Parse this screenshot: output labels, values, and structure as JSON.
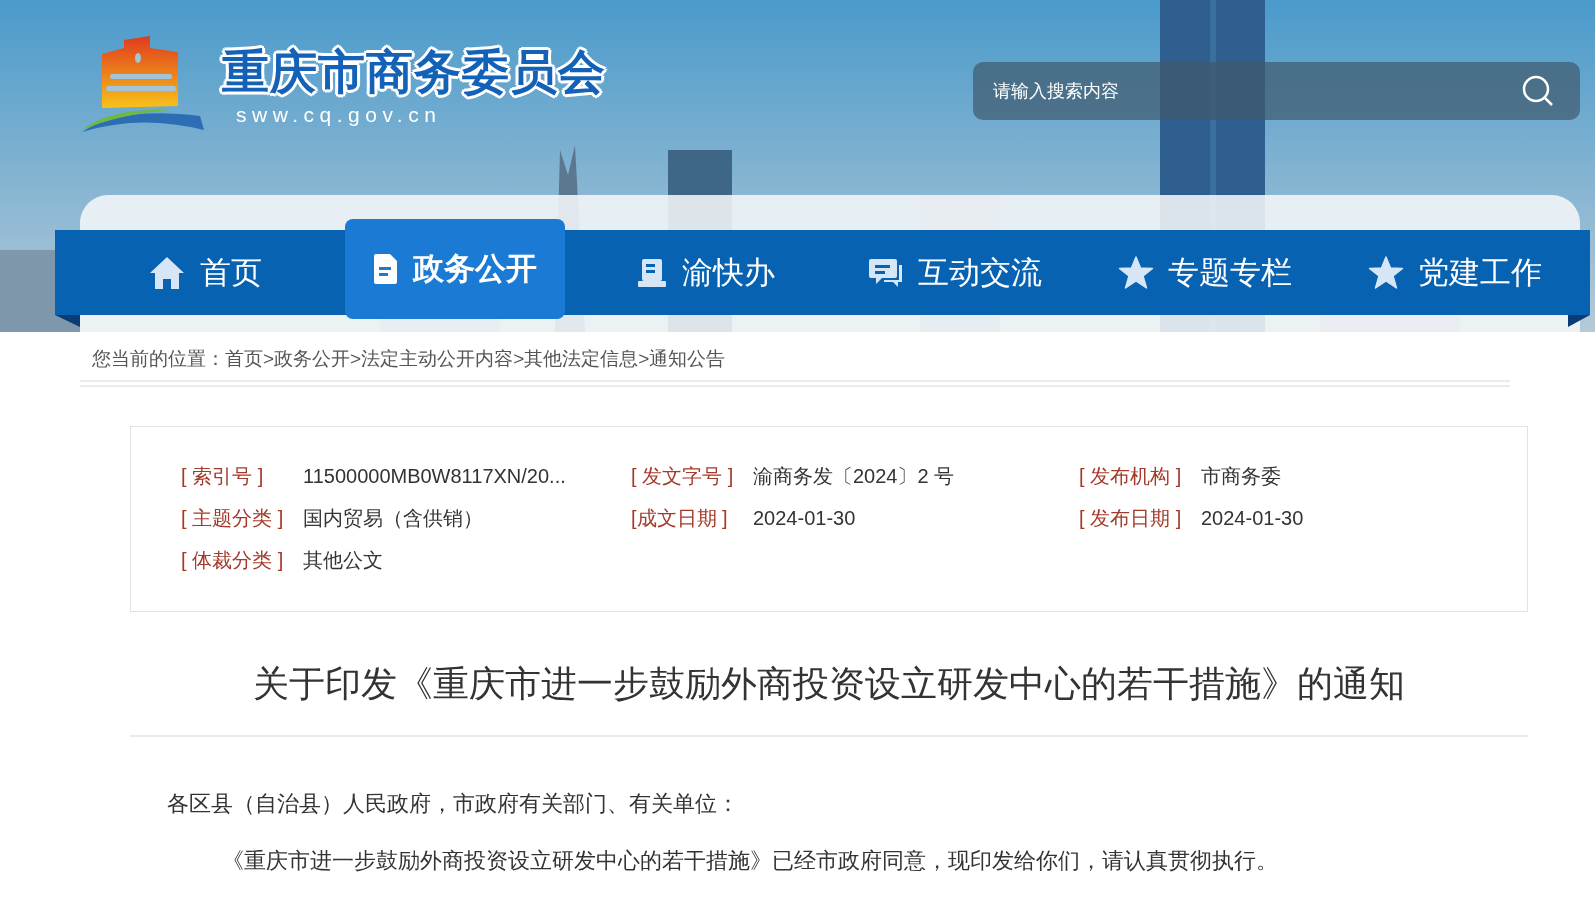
{
  "header": {
    "site_name": "重庆市商务委员会",
    "site_domain": "sww.cq.gov.cn",
    "search": {
      "placeholder": "请输入搜索内容"
    }
  },
  "nav": [
    {
      "label": "首页",
      "selected": false
    },
    {
      "label": "政务公开",
      "selected": true
    },
    {
      "label": "渝快办",
      "selected": false
    },
    {
      "label": "互动交流",
      "selected": false
    },
    {
      "label": "专题专栏",
      "selected": false
    },
    {
      "label": "党建工作",
      "selected": false
    }
  ],
  "breadcrumb": "您当前的位置：首页>政务公开>法定主动公开内容>其他法定信息>通知公告",
  "info": [
    {
      "label": "[ 索引号 ]",
      "value": "11500000MB0W8117XN/20..."
    },
    {
      "label": "[ 发文字号 ]",
      "value": "渝商务发〔2024〕2 号"
    },
    {
      "label": "[ 发布机构 ]",
      "value": "市商务委"
    },
    {
      "label": "[ 主题分类 ]",
      "value": "国内贸易（含供销）"
    },
    {
      "label": "[成文日期 ]",
      "value": "2024-01-30"
    },
    {
      "label": "[ 发布日期 ]",
      "value": "2024-01-30"
    },
    {
      "label": "[ 体裁分类 ]",
      "value": "其他公文"
    }
  ],
  "article": {
    "title": "关于印发《重庆市进一步鼓励外商投资设立研发中心的若干措施》的通知",
    "paragraphs": [
      {
        "kind": "salutation",
        "text": "各区县（自治县）人民政府，市政府有关部门、有关单位："
      },
      {
        "kind": "body",
        "text": "《重庆市进一步鼓励外商投资设立研发中心的若干措施》已经市政府同意，现印发给你们，请认真贯彻执行。"
      }
    ]
  }
}
